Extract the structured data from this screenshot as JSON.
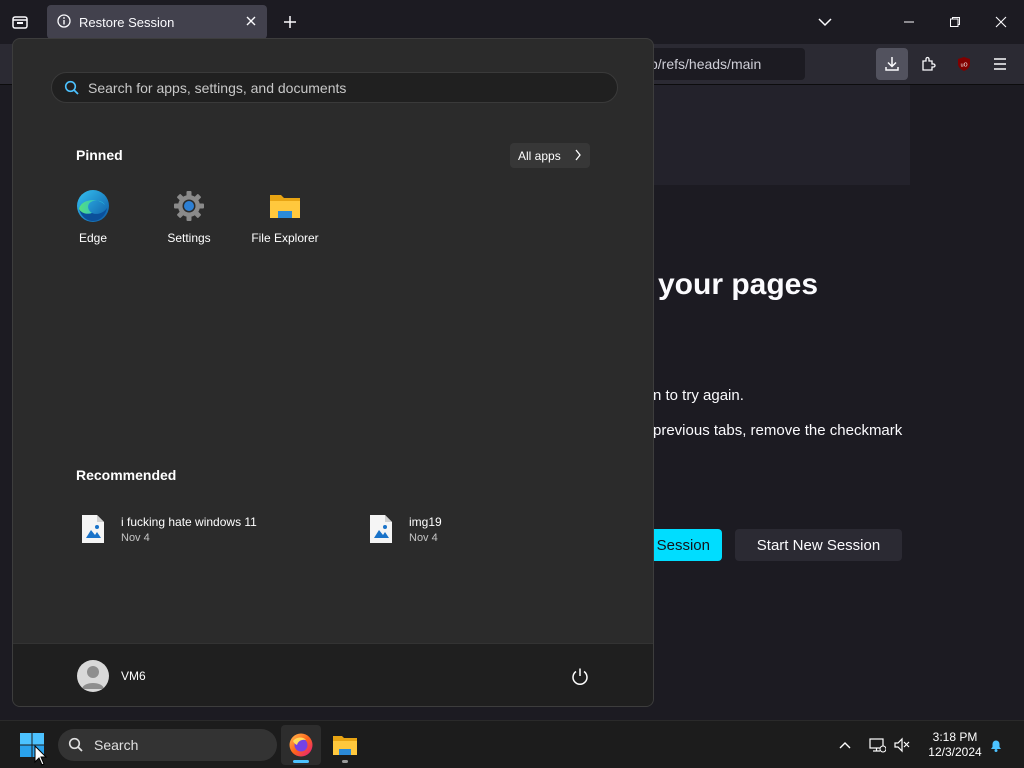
{
  "browser": {
    "active_tab_title": "Restore Session",
    "url_visible": "p/refs/heads/main",
    "icons": [
      "firefox-view-icon",
      "info-icon",
      "close-tab-icon",
      "new-tab-icon",
      "list-all-tabs-icon",
      "download-icon",
      "extensions-icon",
      "ublock-icon",
      "menu-icon"
    ],
    "window_controls": [
      "minimize",
      "restore",
      "close"
    ]
  },
  "page": {
    "title_fragment": "your pages",
    "line1_fragment": "n to try again.",
    "line2_fragment": "previous tabs, remove the checkmark",
    "restore_button_fragment": "Session",
    "new_session_button": "Start New Session"
  },
  "start_menu": {
    "search_placeholder": "Search for apps, settings, and documents",
    "pinned_title": "Pinned",
    "all_apps_label": "All apps",
    "pinned": [
      {
        "label": "Edge",
        "icon": "edge-icon"
      },
      {
        "label": "Settings",
        "icon": "settings-gear-icon"
      },
      {
        "label": "File Explorer",
        "icon": "folder-icon"
      }
    ],
    "recommended_title": "Recommended",
    "recommended": [
      {
        "name": "i fucking hate windows 11",
        "date": "Nov 4"
      },
      {
        "name": "img19",
        "date": "Nov 4"
      }
    ],
    "user_name": "VM6"
  },
  "taskbar": {
    "search_label": "Search",
    "time": "3:18 PM",
    "date": "12/3/2024",
    "apps": [
      "firefox-icon",
      "file-explorer-icon"
    ]
  },
  "colors": {
    "accent_cyan": "#00ddff",
    "start_menu_bg": "#2b2b2b",
    "taskbar_bg": "#1c1c1c",
    "browser_bg": "#1c1b22"
  }
}
